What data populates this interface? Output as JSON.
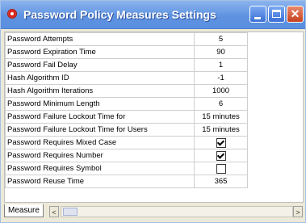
{
  "window": {
    "title": "Password Policy Measures Settings"
  },
  "settings": [
    {
      "label": "Password Attempts",
      "value": "5"
    },
    {
      "label": "Password Expiration Time",
      "value": "90"
    },
    {
      "label": "Password Fail Delay",
      "value": "1"
    },
    {
      "label": "Hash Algorithm ID",
      "value": "-1"
    },
    {
      "label": "Hash Algorithm Iterations",
      "value": "1000"
    },
    {
      "label": "Password Minimum Length",
      "value": "6"
    },
    {
      "label": "Password Failure Lockout Time for",
      "value": "15 minutes"
    },
    {
      "label": "Password Failure Lockout Time for Users",
      "value": "15 minutes"
    },
    {
      "label": "Password Requires Mixed Case",
      "checked": true
    },
    {
      "label": "Password Requires Number",
      "checked": true
    },
    {
      "label": "Password Requires Symbol",
      "checked": false
    },
    {
      "label": "Password Reuse Time",
      "value": "365"
    }
  ],
  "footer": {
    "tab_label": "Measure",
    "scroll_left_glyph": "<",
    "scroll_right_glyph": ">"
  },
  "icons": {
    "app": "oracle-o-icon",
    "minimize": "minimize-icon",
    "maximize": "maximize-icon",
    "close": "close-icon"
  }
}
